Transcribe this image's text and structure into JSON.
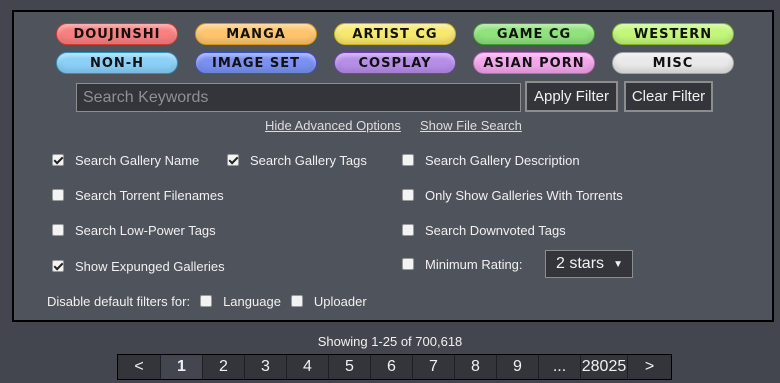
{
  "categories": [
    {
      "label": "DOUJINSHI",
      "color": "#fa7f7f",
      "border": "#d83535"
    },
    {
      "label": "MANGA",
      "color": "#ffc56e",
      "border": "#d9920b"
    },
    {
      "label": "ARTIST CG",
      "color": "#f7e96e",
      "border": "#ccb210"
    },
    {
      "label": "GAME CG",
      "color": "#8fe27c",
      "border": "#3d9d2a"
    },
    {
      "label": "WESTERN",
      "color": "#c3f77a",
      "border": "#7ab629"
    },
    {
      "label": "NON-H",
      "color": "#8ad0f7",
      "border": "#2d8fc6"
    },
    {
      "label": "IMAGE SET",
      "color": "#7a90f2",
      "border": "#3a4fd0"
    },
    {
      "label": "COSPLAY",
      "color": "#b68ee8",
      "border": "#7240bd"
    },
    {
      "label": "ASIAN PORN",
      "color": "#f3a6ec",
      "border": "#c461b8"
    },
    {
      "label": "MISC",
      "color": "#e9e9e9",
      "border": "#a3a3a3"
    }
  ],
  "search": {
    "placeholder": "Search Keywords",
    "value": "",
    "apply_label": "Apply Filter",
    "clear_label": "Clear Filter"
  },
  "links": {
    "hide_advanced": "Hide Advanced Options",
    "show_file_search": "Show File Search"
  },
  "options": [
    {
      "label": "Search Gallery Name",
      "checked": true
    },
    {
      "label": "Search Gallery Tags",
      "checked": true
    },
    {
      "label": "Search Gallery Description",
      "checked": false
    },
    {
      "label": "Search Torrent Filenames",
      "checked": false
    },
    {
      "label": "Only Show Galleries With Torrents",
      "checked": false
    },
    {
      "label": "Search Low-Power Tags",
      "checked": false
    },
    {
      "label": "Search Downvoted Tags",
      "checked": false
    },
    {
      "label": "Show Expunged Galleries",
      "checked": true
    },
    {
      "label": "Minimum Rating:",
      "checked": false
    }
  ],
  "rating": {
    "selected": "2 stars",
    "arrow": "▼"
  },
  "disable_filters": {
    "label": "Disable default filters for:",
    "items": [
      {
        "label": "Language",
        "checked": false
      },
      {
        "label": "Uploader",
        "checked": false
      }
    ]
  },
  "results": {
    "showing": "Showing 1-25 of 700,618"
  },
  "pagination": {
    "prev": "<",
    "pages": [
      "1",
      "2",
      "3",
      "4",
      "5",
      "6",
      "7",
      "8",
      "9",
      "...",
      "28025"
    ],
    "next": ">",
    "current": "1"
  }
}
